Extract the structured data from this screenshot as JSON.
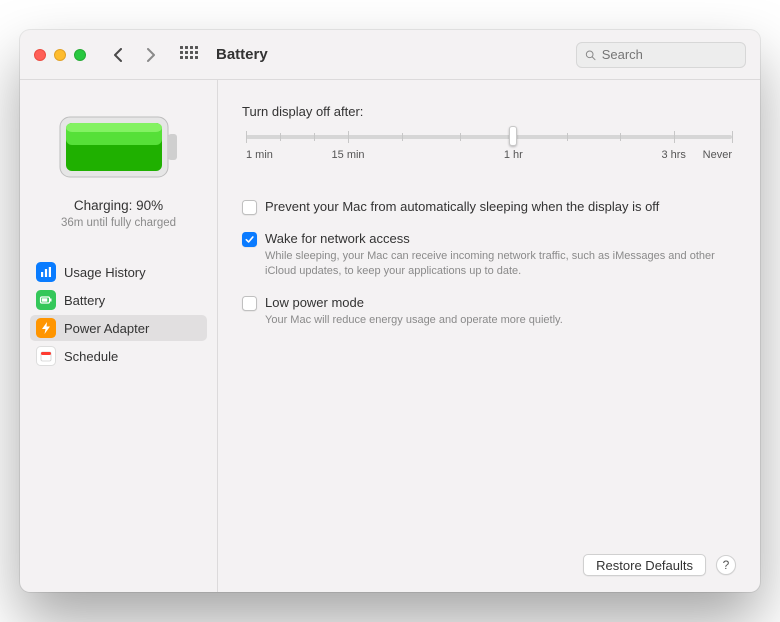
{
  "toolbar": {
    "title": "Battery",
    "search_placeholder": "Search"
  },
  "sidebar": {
    "status_primary": "Charging: 90%",
    "status_secondary": "36m until fully charged",
    "items": [
      {
        "label": "Usage History",
        "icon": "chart-bar-icon",
        "color": "#097cff",
        "selected": false
      },
      {
        "label": "Battery",
        "icon": "battery-icon",
        "color": "#34c759",
        "selected": false
      },
      {
        "label": "Power Adapter",
        "icon": "bolt-icon",
        "color": "#ff9500",
        "selected": true
      },
      {
        "label": "Schedule",
        "icon": "calendar-icon",
        "color": "#ffffff",
        "selected": false
      }
    ]
  },
  "main": {
    "slider": {
      "label": "Turn display off after:",
      "ticks": [
        "1 min",
        "15 min",
        "1 hr",
        "3 hrs",
        "Never"
      ],
      "value_position_percent": 55
    },
    "options": [
      {
        "label": "Prevent your Mac from automatically sleeping when the display is off",
        "description": "",
        "checked": false
      },
      {
        "label": "Wake for network access",
        "description": "While sleeping, your Mac can receive incoming network traffic, such as iMessages and other iCloud updates, to keep your applications up to date.",
        "checked": true
      },
      {
        "label": "Low power mode",
        "description": "Your Mac will reduce energy usage and operate more quietly.",
        "checked": false
      }
    ],
    "footer": {
      "restore_label": "Restore Defaults",
      "help_label": "?"
    }
  }
}
